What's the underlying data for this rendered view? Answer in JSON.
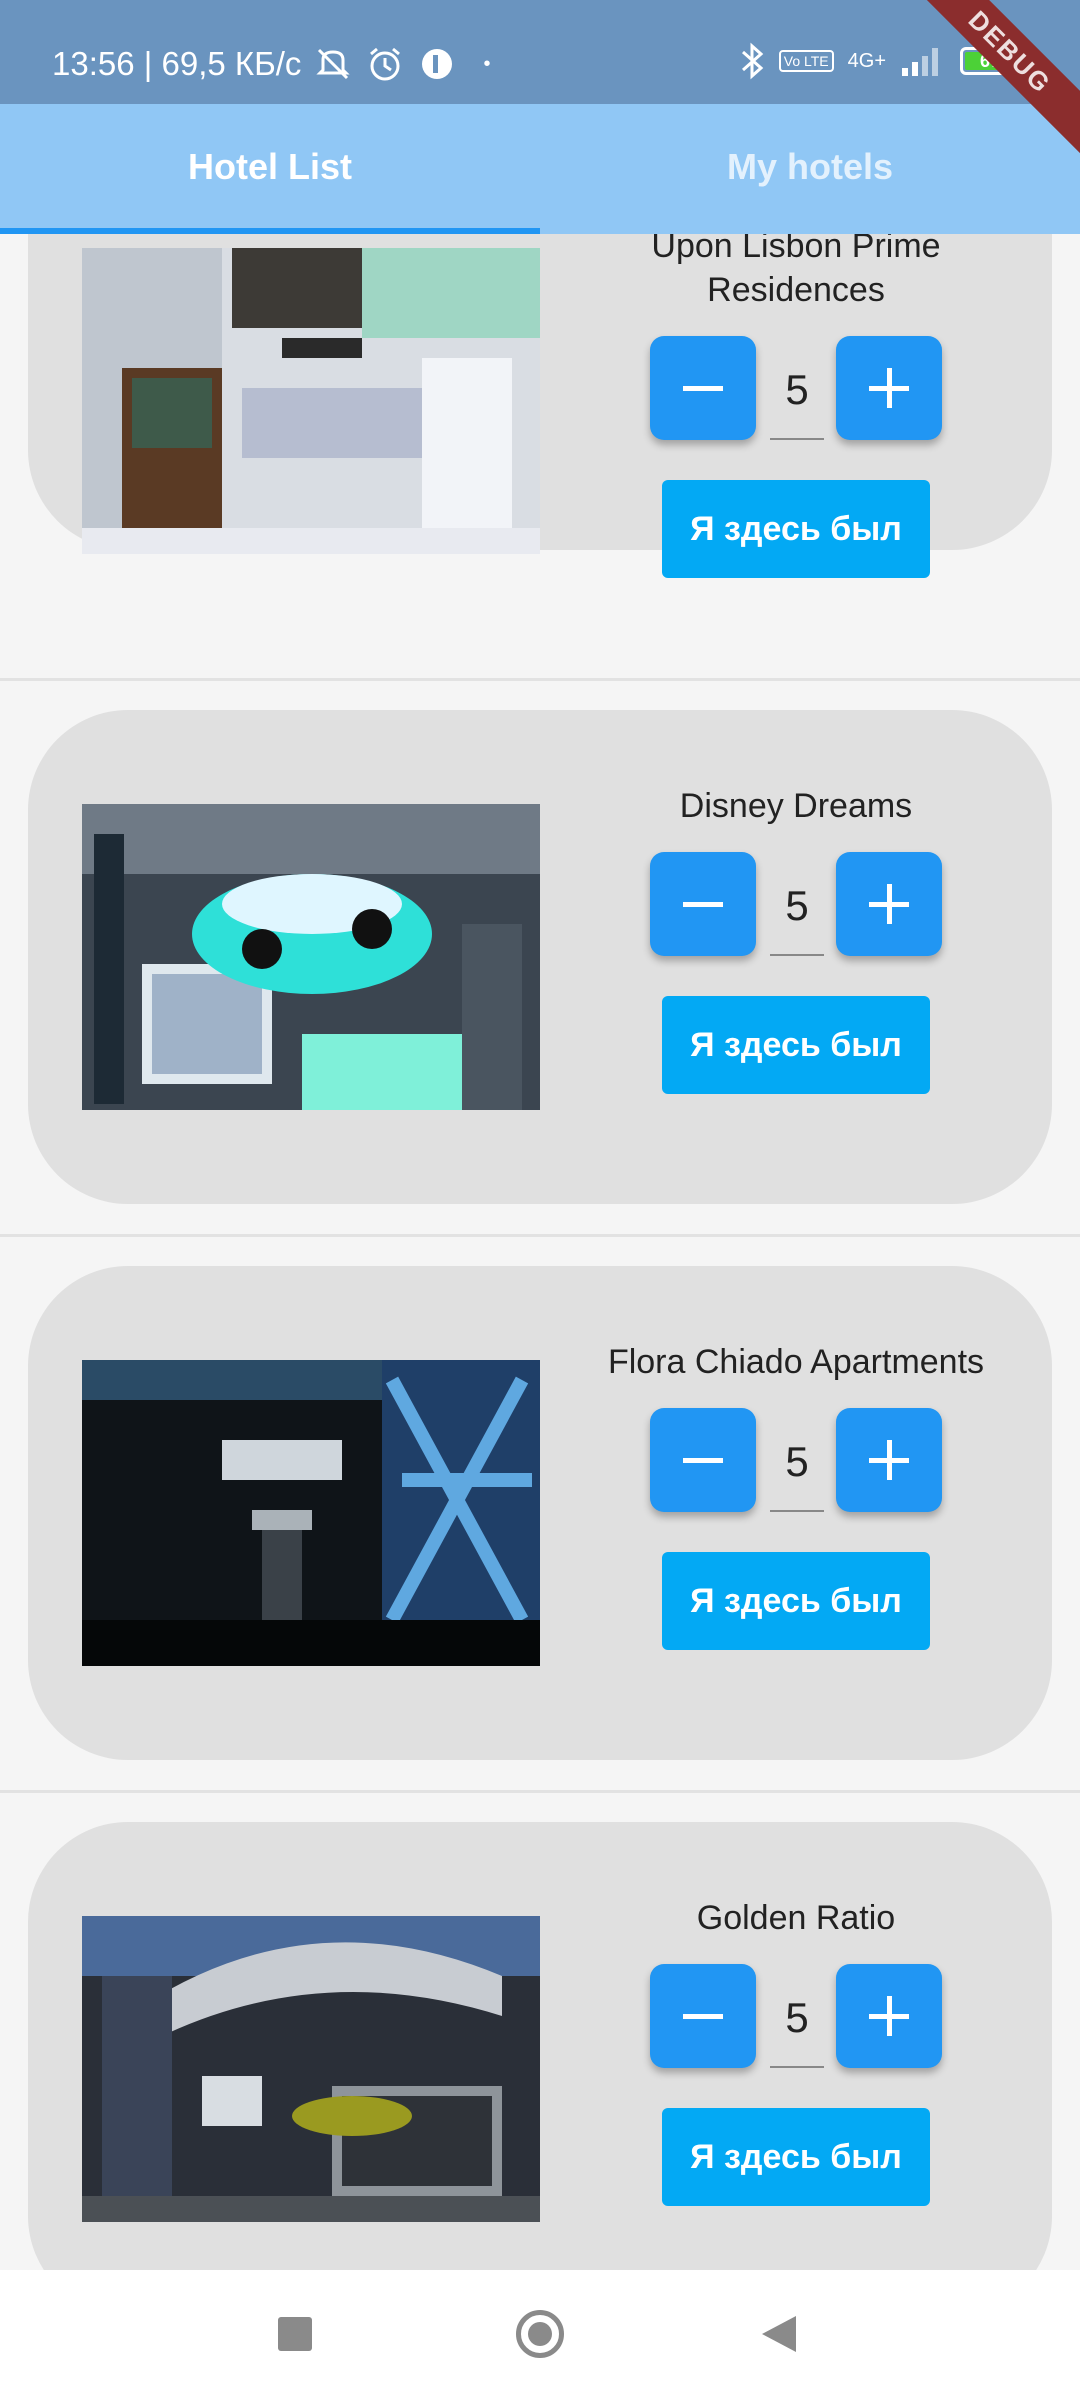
{
  "status_bar": {
    "time_speed": "13:56 | 69,5 КБ/с",
    "icons": [
      "mute-icon",
      "alarm-icon",
      "app-icon",
      "dot-icon",
      "bluetooth-icon",
      "volte-icon",
      "signal-icon",
      "battery-icon"
    ],
    "network": "4G+",
    "volte": "Vo LTE",
    "battery": "67",
    "debug": "DEBUG"
  },
  "tabs": [
    {
      "label": "Hotel List",
      "active": true
    },
    {
      "label": "My hotels",
      "active": false
    }
  ],
  "hotels": [
    {
      "name": "Upon Lisbon Prime Residences",
      "count": "5",
      "button": "Я здесь был"
    },
    {
      "name": "Disney Dreams",
      "count": "5",
      "button": "Я здесь был"
    },
    {
      "name": "Flora Chiado Apartments",
      "count": "5",
      "button": "Я здесь был"
    },
    {
      "name": "Golden Ratio",
      "count": "5",
      "button": "Я здесь был"
    }
  ],
  "colors": {
    "status_bar": "#6a94bf",
    "tab_bar": "#90c7f5",
    "accent": "#2196f3",
    "visited_button": "#03a9f4",
    "card": "#e0e0e0"
  }
}
